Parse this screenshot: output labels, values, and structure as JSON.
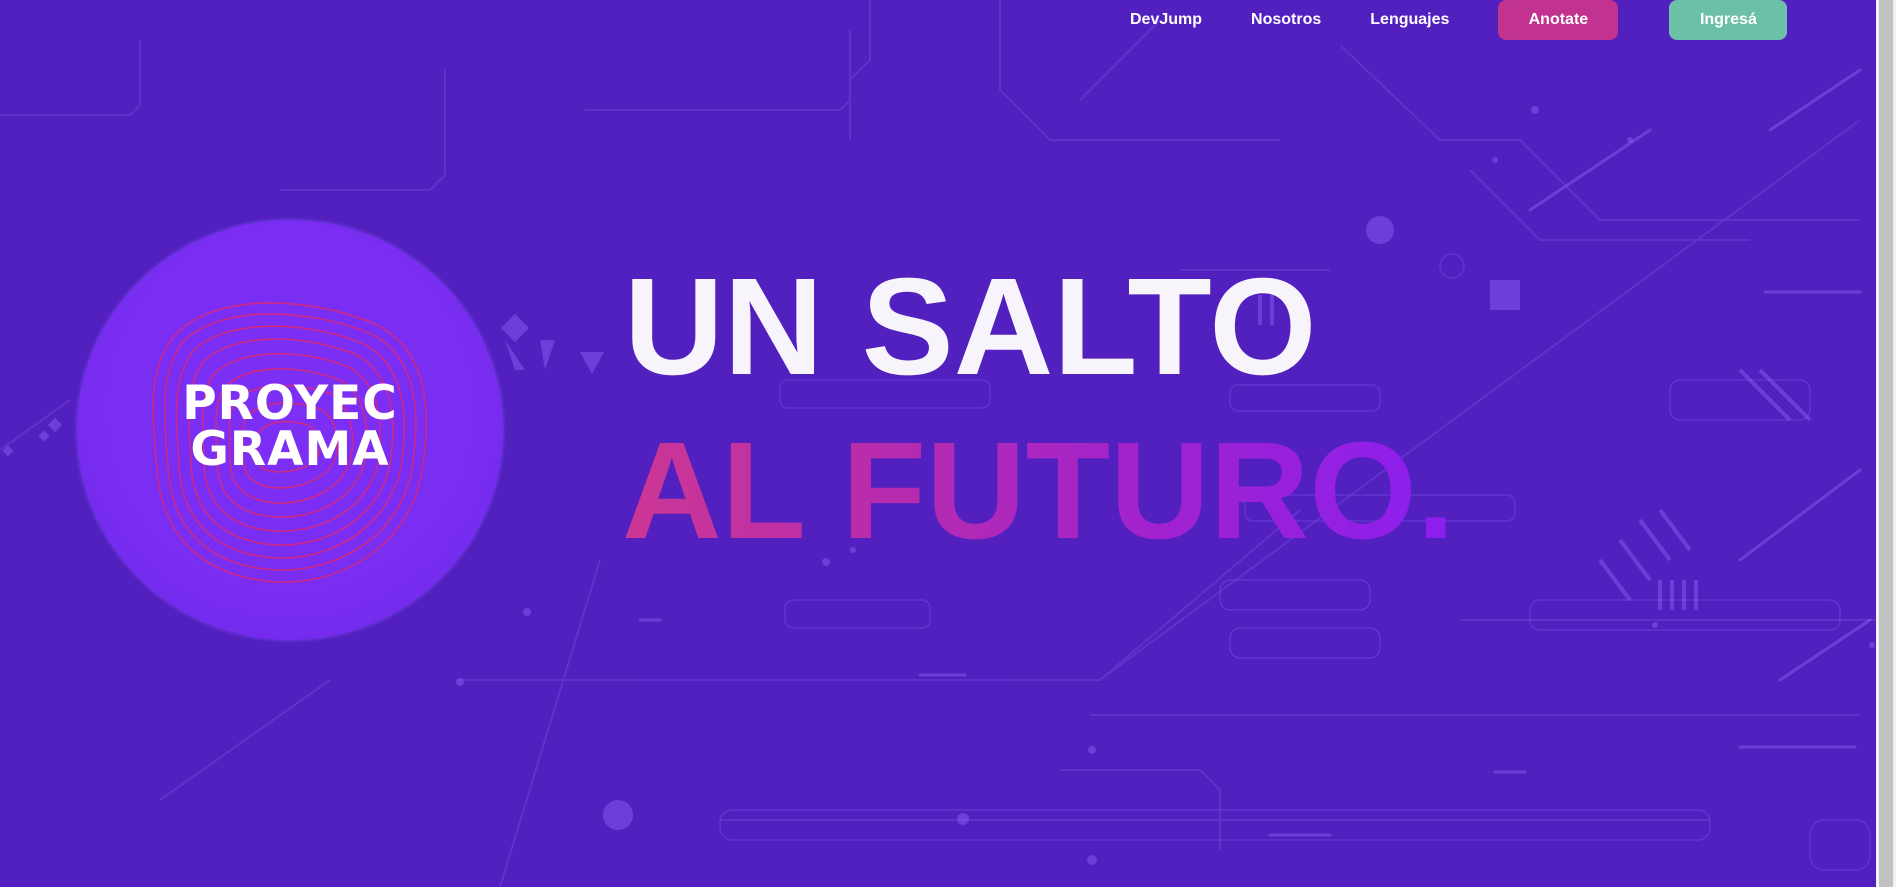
{
  "nav": {
    "links": [
      {
        "label": "DevJump"
      },
      {
        "label": "Nosotros"
      },
      {
        "label": "Lenguajes"
      }
    ],
    "anotate_label": "Anotate",
    "ingresa_label": "Ingresá"
  },
  "logo": {
    "line1": "PROYEC",
    "line2": "GRAMA"
  },
  "hero": {
    "line1": "UN SALTO",
    "line2": "AL FUTURO."
  },
  "colors": {
    "background": "#5120be",
    "anotate_button": "#c2328f",
    "ingresa_button": "#6cc0a8",
    "headline_white": "#f7f5fb",
    "headline_gradient_start": "#cc3694",
    "headline_gradient_end": "#8b1ef0",
    "logo_circle": "#7a2ef2"
  }
}
